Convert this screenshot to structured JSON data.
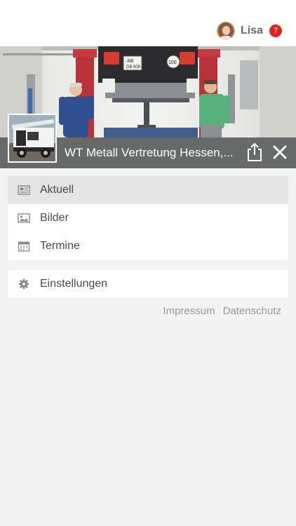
{
  "user": {
    "name": "Lisa",
    "notifications": "7"
  },
  "header": {
    "title": "WT Metall Vertretung Hessen,..."
  },
  "hero": {
    "plate_line1": "AB",
    "plate_line2": "DB 608",
    "plate_right": "100"
  },
  "menu": {
    "main": [
      {
        "label": "Aktuell",
        "icon": "news-icon",
        "active": true
      },
      {
        "label": "Bilder",
        "icon": "image-icon",
        "active": false
      },
      {
        "label": "Termine",
        "icon": "calendar-icon",
        "active": false
      }
    ],
    "secondary": [
      {
        "label": "Einstellungen",
        "icon": "gear-icon",
        "active": false
      }
    ]
  },
  "footer": {
    "impressum": "Impressum",
    "datenschutz": "Datenschutz"
  },
  "colors": {
    "accent_badge": "#e2231a",
    "titlebar": "#666a69",
    "background": "#f3f3f3"
  }
}
